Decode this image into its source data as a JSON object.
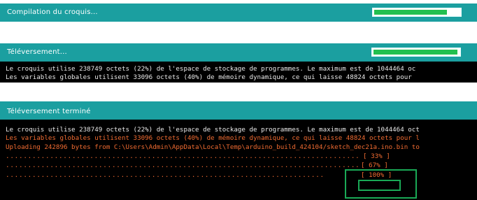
{
  "panel1": {
    "status": "Compilation du croquis...",
    "progress": 0.85
  },
  "panel2": {
    "status": "Téléversement...",
    "progress": 0.98,
    "lines": [
      "Le croquis utilise 238749 octets (22%) de l'espace de stockage de programmes. Le maximum est de 1044464 oc",
      "Les variables globales utilisent 33096 octets (40%) de mémoire dynamique, ce qui laisse 48824 octets pour"
    ]
  },
  "panel3": {
    "status": "Téléversement terminé",
    "lines": [
      "Le croquis utilise 238749 octets (22%) de l'espace de stockage de programmes. Le maximum est de 1044464 oct",
      "Les variables globales utilisent 33096 octets (40%) de mémoire dynamique, ce qui laisse 48824 octets pour l",
      "Uploading 242896 bytes from C:\\Users\\Admin\\AppData\\Local\\Temp\\arduino_build_424104/sketch_dec21a.ino.bin to"
    ],
    "progress_33": "[ 33% ]",
    "progress_67": "[ 67% ]",
    "progress_100": "[ 100% ]"
  },
  "colors": {
    "header": "#1b9fa0",
    "progress": "#22c04f",
    "console_bg": "#000000",
    "console_text": "#e9e9e9",
    "console_orange": "#f06b31",
    "highlight": "#1aa956"
  }
}
